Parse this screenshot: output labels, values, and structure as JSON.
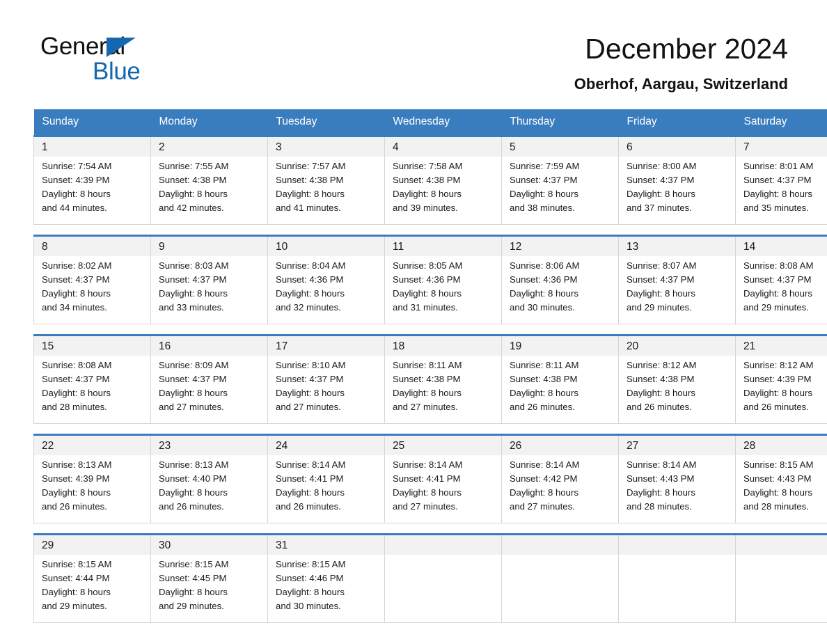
{
  "brand": {
    "name_part1": "General",
    "name_part2": "Blue",
    "triangle_color": "#1368b0"
  },
  "header": {
    "month_title": "December 2024",
    "location": "Oberhof, Aargau, Switzerland"
  },
  "theme": {
    "header_blue": "#3a7dbf",
    "date_band": "#f2f2f2",
    "grid_border": "#d5d5d5",
    "text": "#1a1a1a"
  },
  "calendar": {
    "weekday_headers": [
      "Sunday",
      "Monday",
      "Tuesday",
      "Wednesday",
      "Thursday",
      "Friday",
      "Saturday"
    ],
    "weeks": [
      {
        "days": [
          {
            "date": "1",
            "sunrise": "Sunrise: 7:54 AM",
            "sunset": "Sunset: 4:39 PM",
            "daylight_1": "Daylight: 8 hours",
            "daylight_2": "and 44 minutes."
          },
          {
            "date": "2",
            "sunrise": "Sunrise: 7:55 AM",
            "sunset": "Sunset: 4:38 PM",
            "daylight_1": "Daylight: 8 hours",
            "daylight_2": "and 42 minutes."
          },
          {
            "date": "3",
            "sunrise": "Sunrise: 7:57 AM",
            "sunset": "Sunset: 4:38 PM",
            "daylight_1": "Daylight: 8 hours",
            "daylight_2": "and 41 minutes."
          },
          {
            "date": "4",
            "sunrise": "Sunrise: 7:58 AM",
            "sunset": "Sunset: 4:38 PM",
            "daylight_1": "Daylight: 8 hours",
            "daylight_2": "and 39 minutes."
          },
          {
            "date": "5",
            "sunrise": "Sunrise: 7:59 AM",
            "sunset": "Sunset: 4:37 PM",
            "daylight_1": "Daylight: 8 hours",
            "daylight_2": "and 38 minutes."
          },
          {
            "date": "6",
            "sunrise": "Sunrise: 8:00 AM",
            "sunset": "Sunset: 4:37 PM",
            "daylight_1": "Daylight: 8 hours",
            "daylight_2": "and 37 minutes."
          },
          {
            "date": "7",
            "sunrise": "Sunrise: 8:01 AM",
            "sunset": "Sunset: 4:37 PM",
            "daylight_1": "Daylight: 8 hours",
            "daylight_2": "and 35 minutes."
          }
        ]
      },
      {
        "days": [
          {
            "date": "8",
            "sunrise": "Sunrise: 8:02 AM",
            "sunset": "Sunset: 4:37 PM",
            "daylight_1": "Daylight: 8 hours",
            "daylight_2": "and 34 minutes."
          },
          {
            "date": "9",
            "sunrise": "Sunrise: 8:03 AM",
            "sunset": "Sunset: 4:37 PM",
            "daylight_1": "Daylight: 8 hours",
            "daylight_2": "and 33 minutes."
          },
          {
            "date": "10",
            "sunrise": "Sunrise: 8:04 AM",
            "sunset": "Sunset: 4:36 PM",
            "daylight_1": "Daylight: 8 hours",
            "daylight_2": "and 32 minutes."
          },
          {
            "date": "11",
            "sunrise": "Sunrise: 8:05 AM",
            "sunset": "Sunset: 4:36 PM",
            "daylight_1": "Daylight: 8 hours",
            "daylight_2": "and 31 minutes."
          },
          {
            "date": "12",
            "sunrise": "Sunrise: 8:06 AM",
            "sunset": "Sunset: 4:36 PM",
            "daylight_1": "Daylight: 8 hours",
            "daylight_2": "and 30 minutes."
          },
          {
            "date": "13",
            "sunrise": "Sunrise: 8:07 AM",
            "sunset": "Sunset: 4:37 PM",
            "daylight_1": "Daylight: 8 hours",
            "daylight_2": "and 29 minutes."
          },
          {
            "date": "14",
            "sunrise": "Sunrise: 8:08 AM",
            "sunset": "Sunset: 4:37 PM",
            "daylight_1": "Daylight: 8 hours",
            "daylight_2": "and 29 minutes."
          }
        ]
      },
      {
        "days": [
          {
            "date": "15",
            "sunrise": "Sunrise: 8:08 AM",
            "sunset": "Sunset: 4:37 PM",
            "daylight_1": "Daylight: 8 hours",
            "daylight_2": "and 28 minutes."
          },
          {
            "date": "16",
            "sunrise": "Sunrise: 8:09 AM",
            "sunset": "Sunset: 4:37 PM",
            "daylight_1": "Daylight: 8 hours",
            "daylight_2": "and 27 minutes."
          },
          {
            "date": "17",
            "sunrise": "Sunrise: 8:10 AM",
            "sunset": "Sunset: 4:37 PM",
            "daylight_1": "Daylight: 8 hours",
            "daylight_2": "and 27 minutes."
          },
          {
            "date": "18",
            "sunrise": "Sunrise: 8:11 AM",
            "sunset": "Sunset: 4:38 PM",
            "daylight_1": "Daylight: 8 hours",
            "daylight_2": "and 27 minutes."
          },
          {
            "date": "19",
            "sunrise": "Sunrise: 8:11 AM",
            "sunset": "Sunset: 4:38 PM",
            "daylight_1": "Daylight: 8 hours",
            "daylight_2": "and 26 minutes."
          },
          {
            "date": "20",
            "sunrise": "Sunrise: 8:12 AM",
            "sunset": "Sunset: 4:38 PM",
            "daylight_1": "Daylight: 8 hours",
            "daylight_2": "and 26 minutes."
          },
          {
            "date": "21",
            "sunrise": "Sunrise: 8:12 AM",
            "sunset": "Sunset: 4:39 PM",
            "daylight_1": "Daylight: 8 hours",
            "daylight_2": "and 26 minutes."
          }
        ]
      },
      {
        "days": [
          {
            "date": "22",
            "sunrise": "Sunrise: 8:13 AM",
            "sunset": "Sunset: 4:39 PM",
            "daylight_1": "Daylight: 8 hours",
            "daylight_2": "and 26 minutes."
          },
          {
            "date": "23",
            "sunrise": "Sunrise: 8:13 AM",
            "sunset": "Sunset: 4:40 PM",
            "daylight_1": "Daylight: 8 hours",
            "daylight_2": "and 26 minutes."
          },
          {
            "date": "24",
            "sunrise": "Sunrise: 8:14 AM",
            "sunset": "Sunset: 4:41 PM",
            "daylight_1": "Daylight: 8 hours",
            "daylight_2": "and 26 minutes."
          },
          {
            "date": "25",
            "sunrise": "Sunrise: 8:14 AM",
            "sunset": "Sunset: 4:41 PM",
            "daylight_1": "Daylight: 8 hours",
            "daylight_2": "and 27 minutes."
          },
          {
            "date": "26",
            "sunrise": "Sunrise: 8:14 AM",
            "sunset": "Sunset: 4:42 PM",
            "daylight_1": "Daylight: 8 hours",
            "daylight_2": "and 27 minutes."
          },
          {
            "date": "27",
            "sunrise": "Sunrise: 8:14 AM",
            "sunset": "Sunset: 4:43 PM",
            "daylight_1": "Daylight: 8 hours",
            "daylight_2": "and 28 minutes."
          },
          {
            "date": "28",
            "sunrise": "Sunrise: 8:15 AM",
            "sunset": "Sunset: 4:43 PM",
            "daylight_1": "Daylight: 8 hours",
            "daylight_2": "and 28 minutes."
          }
        ]
      },
      {
        "days": [
          {
            "date": "29",
            "sunrise": "Sunrise: 8:15 AM",
            "sunset": "Sunset: 4:44 PM",
            "daylight_1": "Daylight: 8 hours",
            "daylight_2": "and 29 minutes."
          },
          {
            "date": "30",
            "sunrise": "Sunrise: 8:15 AM",
            "sunset": "Sunset: 4:45 PM",
            "daylight_1": "Daylight: 8 hours",
            "daylight_2": "and 29 minutes."
          },
          {
            "date": "31",
            "sunrise": "Sunrise: 8:15 AM",
            "sunset": "Sunset: 4:46 PM",
            "daylight_1": "Daylight: 8 hours",
            "daylight_2": "and 30 minutes."
          },
          {
            "date": "",
            "sunrise": "",
            "sunset": "",
            "daylight_1": "",
            "daylight_2": ""
          },
          {
            "date": "",
            "sunrise": "",
            "sunset": "",
            "daylight_1": "",
            "daylight_2": ""
          },
          {
            "date": "",
            "sunrise": "",
            "sunset": "",
            "daylight_1": "",
            "daylight_2": ""
          },
          {
            "date": "",
            "sunrise": "",
            "sunset": "",
            "daylight_1": "",
            "daylight_2": ""
          }
        ]
      }
    ]
  }
}
